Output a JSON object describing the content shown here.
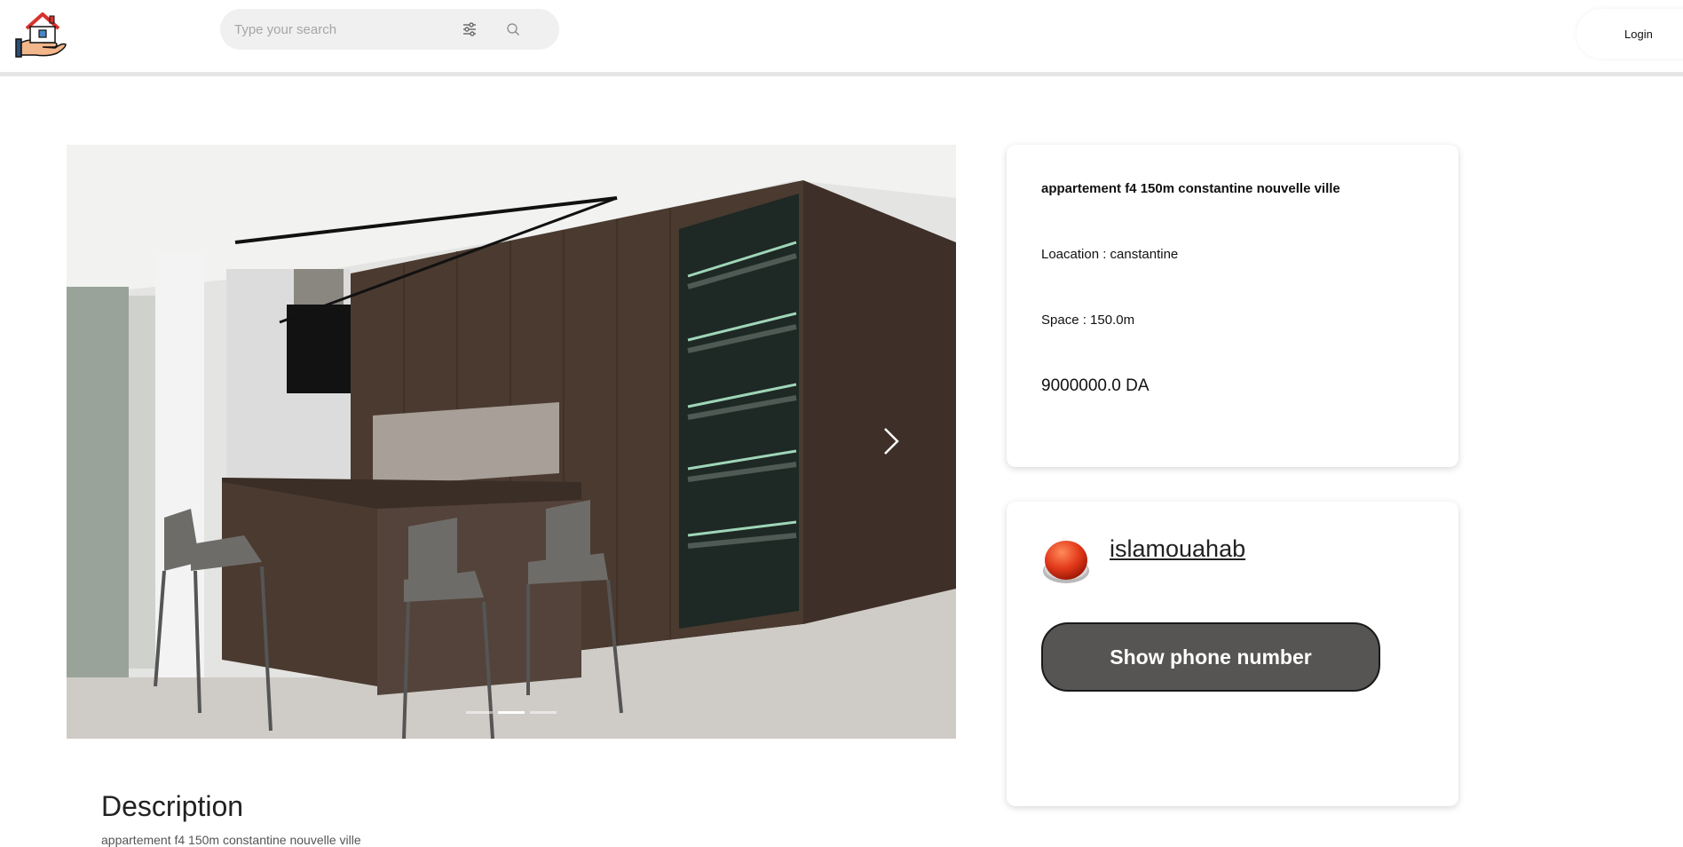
{
  "header": {
    "search_placeholder": "Type your search",
    "login_label": "Login"
  },
  "carousel": {
    "slide_count": 3,
    "active_slide": 2
  },
  "listing": {
    "title": "appartement f4 150m constantine nouvelle ville",
    "location": "Loacation : canstantine",
    "space": "Space : 150.0m",
    "price": "9000000.0 DA"
  },
  "seller": {
    "username": "islamouahab",
    "phone_button_label": "Show phone number"
  },
  "description": {
    "heading": "Description",
    "text": "appartement f4 150m constantine nouvelle ville"
  },
  "icons": {
    "logo": "house-in-hand-logo",
    "filter": "sliders-icon",
    "search": "search-icon",
    "next": "chevron-right-icon",
    "avatar": "red-button-avatar"
  },
  "colors": {
    "phone_button": "#565553",
    "search_bg": "#f0f0f0"
  }
}
